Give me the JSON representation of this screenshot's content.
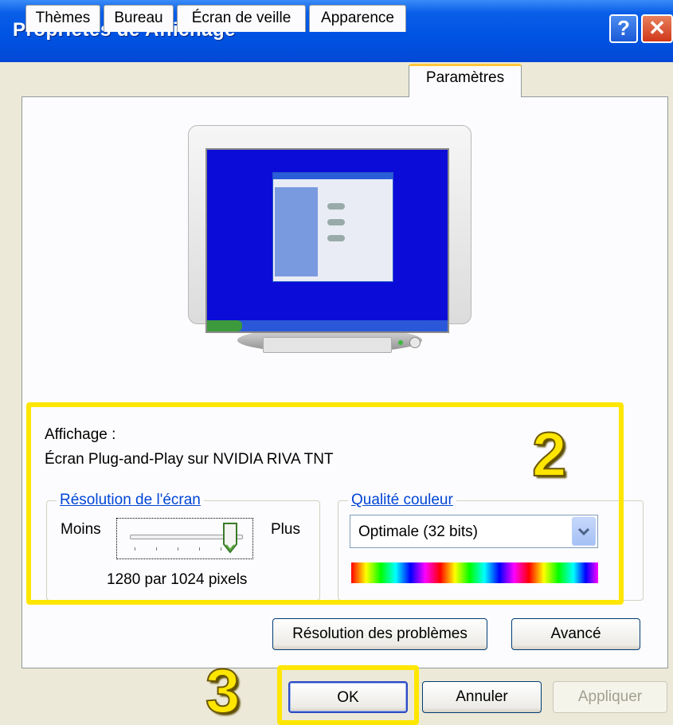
{
  "window": {
    "title": "Propriétés de Affichage",
    "help_glyph": "?",
    "close_glyph": "✕"
  },
  "tabs": [
    {
      "label": "Thèmes"
    },
    {
      "label": "Bureau"
    },
    {
      "label": "Écran de veille"
    },
    {
      "label": "Apparence"
    },
    {
      "label": "Paramètres",
      "active": true
    }
  ],
  "display": {
    "label": "Affichage :",
    "device": "Écran Plug-and-Play sur NVIDIA RIVA TNT"
  },
  "resolution": {
    "legend": "Résolution de l'écran",
    "less_label": "Moins",
    "more_label": "Plus",
    "value_text": "1280 par 1024 pixels",
    "slider_position": 1.0
  },
  "color_quality": {
    "legend": "Qualité couleur",
    "selected": "Optimale (32 bits)"
  },
  "buttons": {
    "troubleshoot": "Résolution des problèmes",
    "advanced": "Avancé",
    "ok": "OK",
    "cancel": "Annuler",
    "apply": "Appliquer"
  },
  "annotations": {
    "step_display": "2",
    "step_ok": "3",
    "highlight_color": "#ffe600"
  }
}
